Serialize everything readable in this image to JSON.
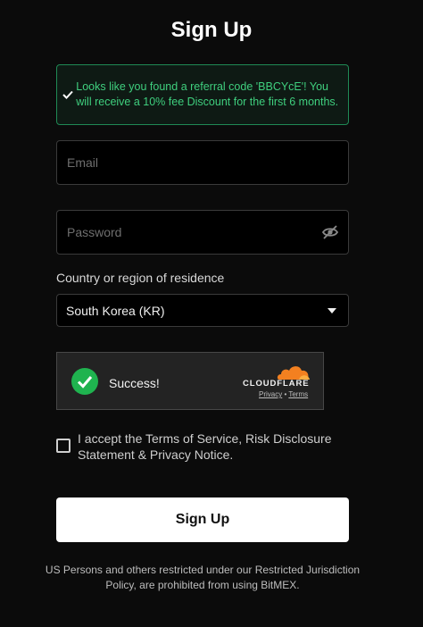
{
  "title": "Sign Up",
  "referral": {
    "message": "Looks like you found a referral code 'BBCYcE'! You will receive a 10% fee Discount for the first 6 months.",
    "icon": "check-icon",
    "color": "#3fcf7e"
  },
  "email": {
    "placeholder": "Email",
    "value": ""
  },
  "password": {
    "placeholder": "Password",
    "value": "",
    "toggle_icon": "eye-off-icon"
  },
  "country": {
    "label": "Country or region of residence",
    "selected": "South Korea (KR)"
  },
  "captcha": {
    "status": "Success!",
    "brand": "CLOUDFLARE",
    "privacy": "Privacy",
    "separator": "•",
    "terms": "Terms",
    "brand_color": "#f38020"
  },
  "terms": {
    "label": "I accept the Terms of Service, Risk Disclosure Statement & Privacy Notice.",
    "checked": false
  },
  "submit_label": "Sign Up",
  "footer": "US Persons and others restricted under our Restricted Jurisdiction Policy, are prohibited from using BitMEX."
}
